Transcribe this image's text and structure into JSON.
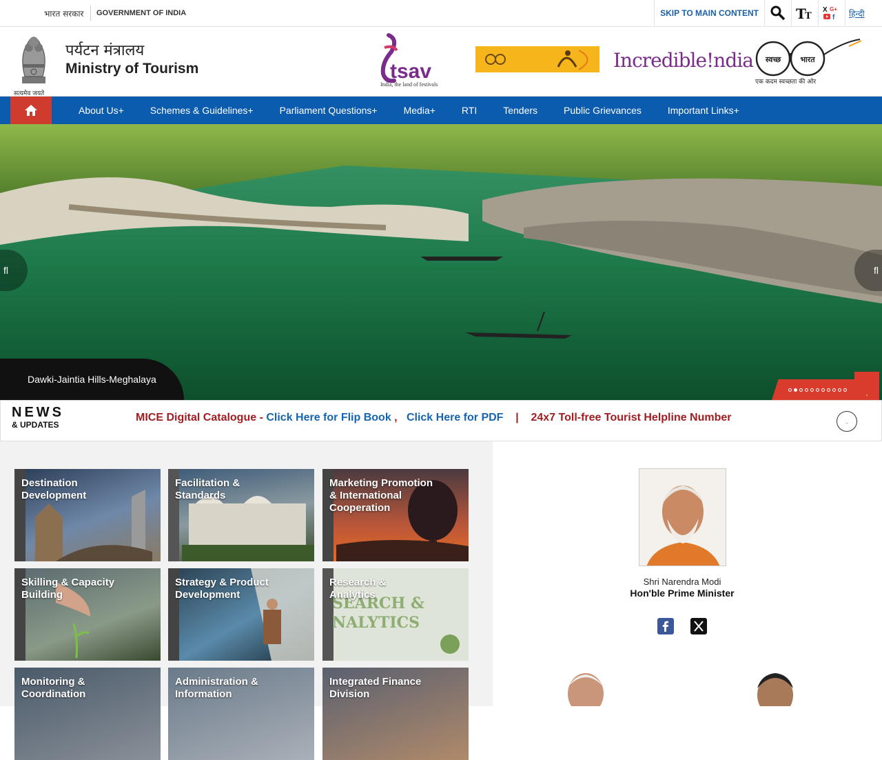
{
  "topbar": {
    "gov_hindi": "भारत सरकार",
    "gov_english": "GOVERNMENT OF INDIA",
    "skip_link": "SKIP TO MAIN CONTENT",
    "language_link": "हिन्दी",
    "icons": [
      "search-icon",
      "text-size-icon",
      "social-media-icon"
    ]
  },
  "header": {
    "motto": "सत्यमेव जयते",
    "title_hindi": "पर्यटन मंत्रालय",
    "title_english": "Ministry of Tourism",
    "utsav_logo_text": "tsav",
    "utsav_tagline": "India, the land of festivals",
    "incredible_india": "Incredible!ndia",
    "swachh_hindi": "स्वच्छ",
    "swachh_bharat": "भारत",
    "swachh_tagline": "एक कदम स्वच्छता की ओर"
  },
  "nav": {
    "items": [
      {
        "label": "About Us+"
      },
      {
        "label": "Schemes & Guidelines+"
      },
      {
        "label": "Parliament Questions+"
      },
      {
        "label": "Media+"
      },
      {
        "label": "RTI"
      },
      {
        "label": "Tenders"
      },
      {
        "label": "Public Grievances"
      },
      {
        "label": "Important Links+"
      }
    ]
  },
  "hero": {
    "caption": "Dawki-Jaintia Hills-Meghalaya",
    "prev_glyph": "fl",
    "next_glyph": "fl",
    "slide_count": 11,
    "active_slide": 2,
    "play_glyph": "‚"
  },
  "news": {
    "heading": "NEWS",
    "subheading": "& UPDATES",
    "ticker_title": "MICE Digital Catalogue - ",
    "ticker_link1": "Click Here for Flip Book",
    "ticker_sep1": " ,   ",
    "ticker_link2": "Click Here for PDF",
    "ticker_sep2": "    |    ",
    "ticker_item2": "24x7 Toll-free Tourist Helpline Number",
    "pause_glyph": "."
  },
  "tiles": [
    {
      "label": "Destination Development"
    },
    {
      "label": "Facilitation & Standards"
    },
    {
      "label": "Marketing Promotion & International Cooperation"
    },
    {
      "label": "Skilling & Capacity Building"
    },
    {
      "label": "Strategy & Product Development"
    },
    {
      "label": "Research & Analytics"
    },
    {
      "label": "Monitoring & Coordination"
    },
    {
      "label": "Administration & Information"
    },
    {
      "label": "Integrated Finance Division"
    }
  ],
  "leader": {
    "name": "Shri Narendra Modi",
    "title": "Hon'ble Prime Minister"
  },
  "colors": {
    "nav_blue": "#0b5cae",
    "home_red": "#cf3c2d",
    "ticker_red": "#a01d22",
    "link_blue": "#1565b0",
    "accent_red": "#d93b2c"
  }
}
